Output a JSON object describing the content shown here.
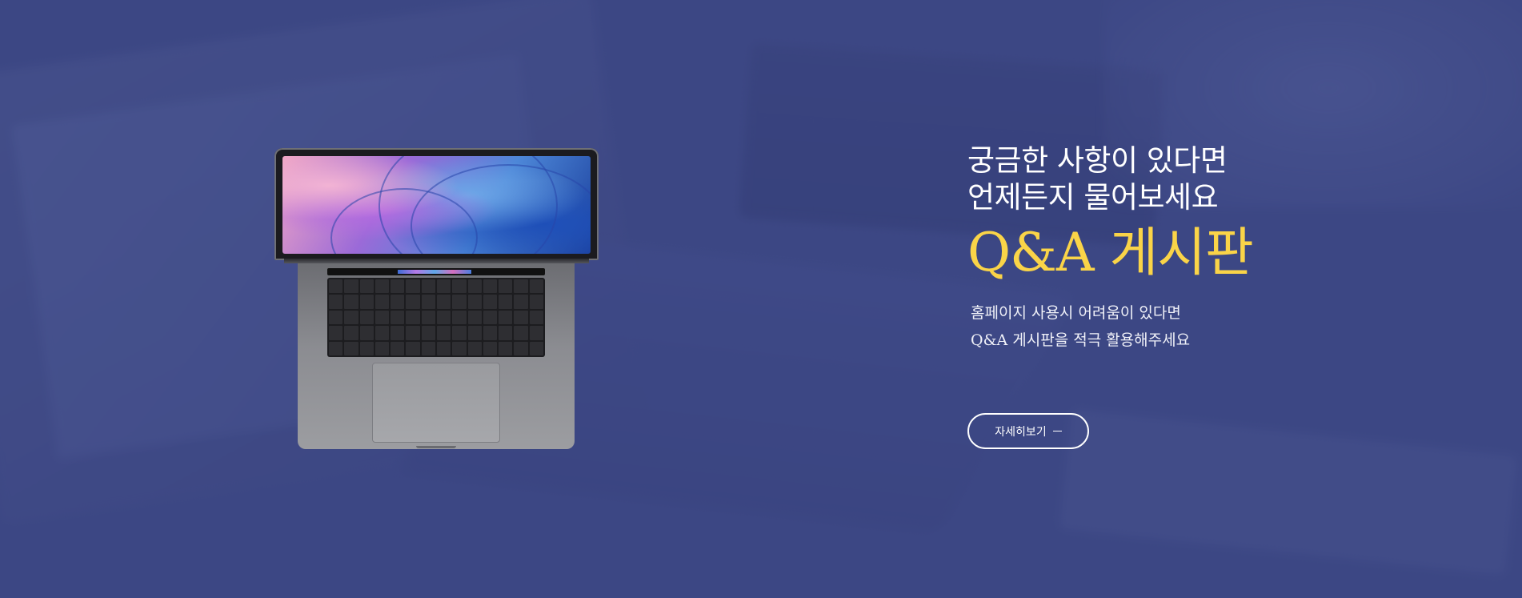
{
  "hero": {
    "headline_line1": "궁금한 사항이 있다면",
    "headline_line2": "언제든지 물어보세요",
    "title": "Q&A 게시판",
    "description_line1": "홈페이지 사용시 어려움이 있다면",
    "description_line2": "Q&A 게시판을 적극 활용해주세요",
    "button_label": "자세히보기",
    "button_icon": "dash-arrow-icon"
  },
  "colors": {
    "background": "#3f4a86",
    "title_accent": "#fad448",
    "text": "#ffffff"
  },
  "images": {
    "laptop": "laptop-image"
  }
}
